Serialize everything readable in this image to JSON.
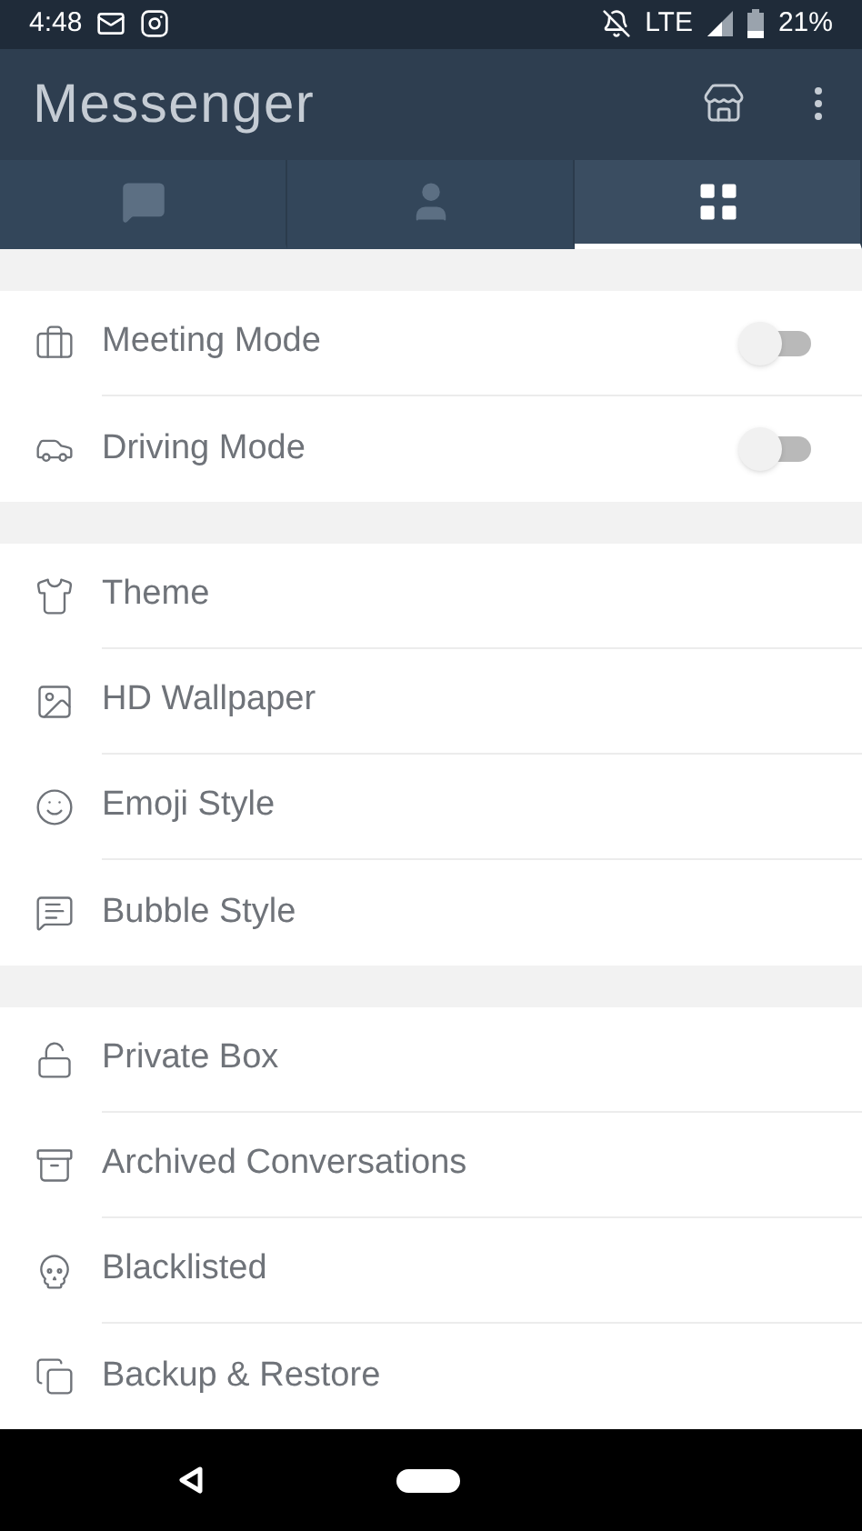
{
  "status_bar": {
    "time": "4:48",
    "network": "LTE",
    "battery": "21%"
  },
  "app_bar": {
    "title": "Messenger"
  },
  "tabs": [
    {
      "kind": "chat",
      "selected": false
    },
    {
      "kind": "contacts",
      "selected": false
    },
    {
      "kind": "grid",
      "selected": true
    }
  ],
  "sections": [
    {
      "items": [
        {
          "kind": "toggle",
          "label": "Meeting Mode",
          "on": false
        },
        {
          "kind": "toggle",
          "label": "Driving Mode",
          "on": false
        }
      ]
    },
    {
      "items": [
        {
          "kind": "link",
          "label": "Theme"
        },
        {
          "kind": "link",
          "label": "HD Wallpaper"
        },
        {
          "kind": "link",
          "label": "Emoji Style"
        },
        {
          "kind": "link",
          "label": "Bubble Style"
        }
      ]
    },
    {
      "items": [
        {
          "kind": "link",
          "label": "Private Box"
        },
        {
          "kind": "link",
          "label": "Archived Conversations"
        },
        {
          "kind": "link",
          "label": "Blacklisted"
        },
        {
          "kind": "link",
          "label": "Backup & Restore"
        }
      ]
    }
  ]
}
